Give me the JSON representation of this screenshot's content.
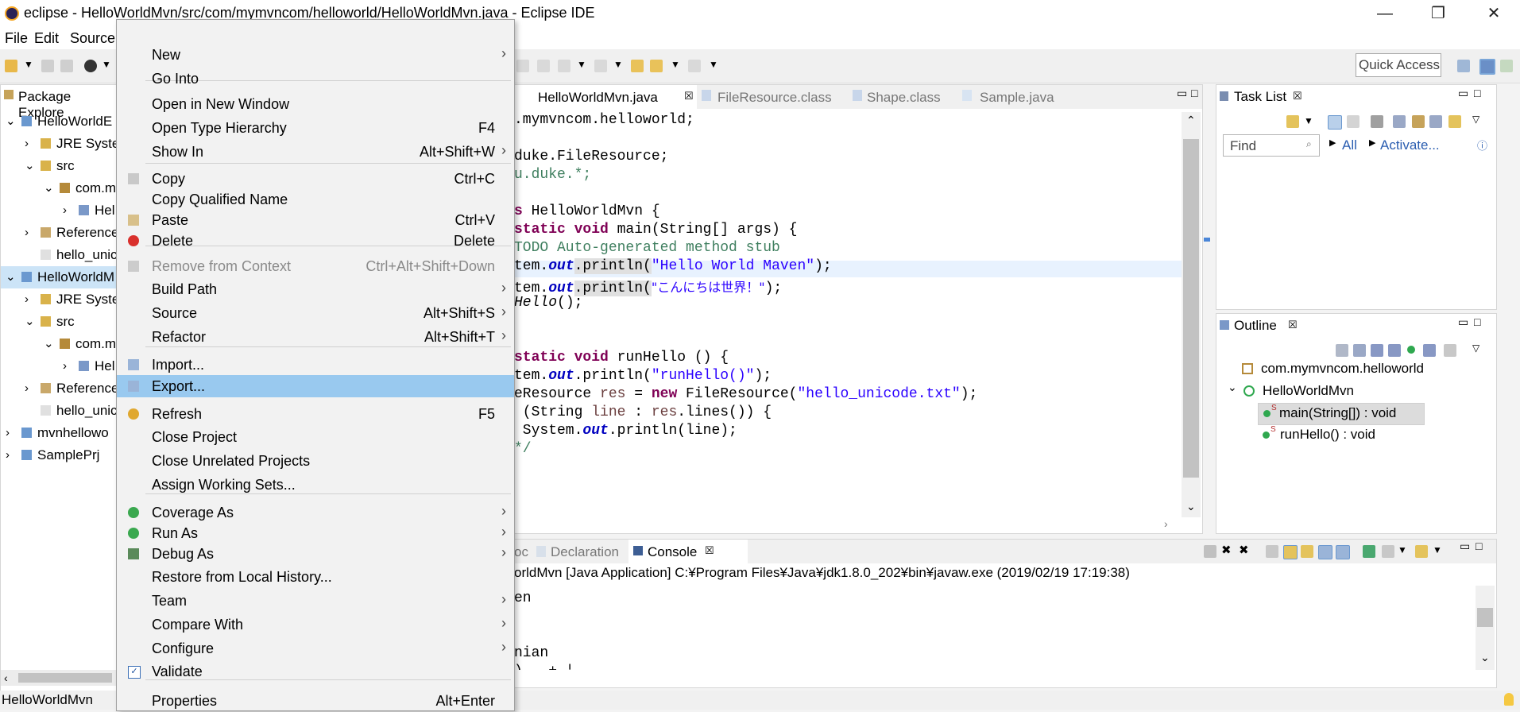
{
  "window": {
    "title": "eclipse - HelloWorldMvn/src/com/mymvncom/helloworld/HelloWorldMvn.java - Eclipse IDE",
    "minimize": "—",
    "maximize": "❐",
    "close": "✕"
  },
  "menubar": [
    "File",
    "Edit",
    "Source"
  ],
  "toolbar": {
    "quick_access": "Quick Access"
  },
  "package_explorer": {
    "tab": "Package Explore",
    "rows": [
      {
        "twisty": "⌄",
        "label": "HelloWorldE"
      },
      {
        "twisty": "›",
        "label": "JRE Syste"
      },
      {
        "twisty": "⌄",
        "label": "src"
      },
      {
        "twisty": "⌄",
        "label": "com.m"
      },
      {
        "twisty": "›",
        "label": "Hel"
      },
      {
        "twisty": "›",
        "label": "Reference"
      },
      {
        "twisty": "",
        "label": "hello_unic"
      },
      {
        "twisty": "⌄",
        "label": "HelloWorldM"
      },
      {
        "twisty": "›",
        "label": "JRE Syste"
      },
      {
        "twisty": "⌄",
        "label": "src"
      },
      {
        "twisty": "⌄",
        "label": "com.m"
      },
      {
        "twisty": "›",
        "label": "Hel"
      },
      {
        "twisty": "›",
        "label": "Reference"
      },
      {
        "twisty": "",
        "label": "hello_unic"
      },
      {
        "twisty": "›",
        "label": "mvnhellowo"
      },
      {
        "twisty": "›",
        "label": "SamplePrj"
      }
    ]
  },
  "editor": {
    "tabs": [
      {
        "label": "HelloWorldMvn.java",
        "close": "☒"
      },
      {
        "label": "FileResource.class"
      },
      {
        "label": "Shape.class"
      },
      {
        "label": "Sample.java"
      }
    ],
    "lines": {
      "l1": ".mymvncom.helloworld;",
      "l3": "duke.FileResource;",
      "l4": "u.duke.*;",
      "l6a": "s ",
      "l6b": "HelloWorldMvn {",
      "l7a": "static void ",
      "l7b": "main(String[] args) {",
      "l8": "TODO Auto-generated method stub",
      "l9a": "tem.",
      "l9b": "out",
      "l9c": ".println(",
      "l9d": "\"Hello World Maven\"",
      "l9e": ");",
      "l10a": "tem.",
      "l10b": "out",
      "l10c": ".println(",
      "l10d": "\"こんにちは世界！\"",
      "l10e": ");",
      "l11a": "Hello",
      "l11b": "();",
      "l14a": "static void ",
      "l14b": "runHello () {",
      "l15a": "tem.",
      "l15b": "out",
      "l15c": ".println(",
      "l15d": "\"runHello()\"",
      "l15e": ");",
      "l16a": "eResource ",
      "l16b": "res",
      "l16c": " = ",
      "l16d": "new",
      "l16e": " FileResource(",
      "l16f": "\"hello_unicode.txt\"",
      "l16g": ");",
      "l17a": " (String ",
      "l17b": "line",
      "l17c": " : ",
      "l17d": "res",
      "l17e": ".lines()) {",
      "l18a": " System.",
      "l18b": "out",
      "l18c": ".println(line);",
      "l19": "*/"
    }
  },
  "task_list": {
    "tab": "Task List",
    "find_placeholder": "Find",
    "all": "All",
    "activate": "Activate..."
  },
  "outline": {
    "tab": "Outline",
    "items": [
      {
        "label": "com.mymvncom.helloworld"
      },
      {
        "label": "HelloWorldMvn"
      },
      {
        "label": "main(String[]) : void"
      },
      {
        "label": "runHello() : void"
      }
    ]
  },
  "console": {
    "tabs": [
      {
        "label": "oc"
      },
      {
        "label": "Declaration"
      },
      {
        "label": "Console"
      }
    ],
    "header": "orldMvn [Java Application] C:¥Program Files¥Java¥jdk1.8.0_202¥bin¥javaw.exe (2019/02/19 17:19:38)",
    "lines": [
      "en",
      "",
      "",
      "nian",
      ") ..+ ¦"
    ]
  },
  "status_bar": {
    "left": "HelloWorldMvn"
  },
  "context_menu": {
    "items": [
      {
        "label": "New",
        "shortcut": "",
        "submenu": true
      },
      {
        "label": "Go Into",
        "shortcut": ""
      },
      {
        "label": "Open in New Window",
        "shortcut": ""
      },
      {
        "label": "Open Type Hierarchy",
        "shortcut": "F4"
      },
      {
        "label": "Show In",
        "shortcut": "Alt+Shift+W",
        "submenu": true
      },
      {
        "label": "Copy",
        "shortcut": "Ctrl+C"
      },
      {
        "label": "Copy Qualified Name",
        "shortcut": ""
      },
      {
        "label": "Paste",
        "shortcut": "Ctrl+V"
      },
      {
        "label": "Delete",
        "shortcut": "Delete"
      },
      {
        "label": "Remove from Context",
        "shortcut": "Ctrl+Alt+Shift+Down",
        "disabled": true
      },
      {
        "label": "Build Path",
        "shortcut": "",
        "submenu": true
      },
      {
        "label": "Source",
        "shortcut": "Alt+Shift+S",
        "submenu": true
      },
      {
        "label": "Refactor",
        "shortcut": "Alt+Shift+T",
        "submenu": true
      },
      {
        "label": "Import...",
        "shortcut": ""
      },
      {
        "label": "Export...",
        "shortcut": "",
        "highlighted": true
      },
      {
        "label": "Refresh",
        "shortcut": "F5"
      },
      {
        "label": "Close Project",
        "shortcut": ""
      },
      {
        "label": "Close Unrelated Projects",
        "shortcut": ""
      },
      {
        "label": "Assign Working Sets...",
        "shortcut": ""
      },
      {
        "label": "Coverage As",
        "shortcut": "",
        "submenu": true
      },
      {
        "label": "Run As",
        "shortcut": "",
        "submenu": true
      },
      {
        "label": "Debug As",
        "shortcut": "",
        "submenu": true
      },
      {
        "label": "Restore from Local History...",
        "shortcut": ""
      },
      {
        "label": "Team",
        "shortcut": "",
        "submenu": true
      },
      {
        "label": "Compare With",
        "shortcut": "",
        "submenu": true
      },
      {
        "label": "Configure",
        "shortcut": "",
        "submenu": true
      },
      {
        "label": "Validate",
        "shortcut": ""
      },
      {
        "label": "Properties",
        "shortcut": "Alt+Enter"
      }
    ],
    "arrow": "›"
  }
}
